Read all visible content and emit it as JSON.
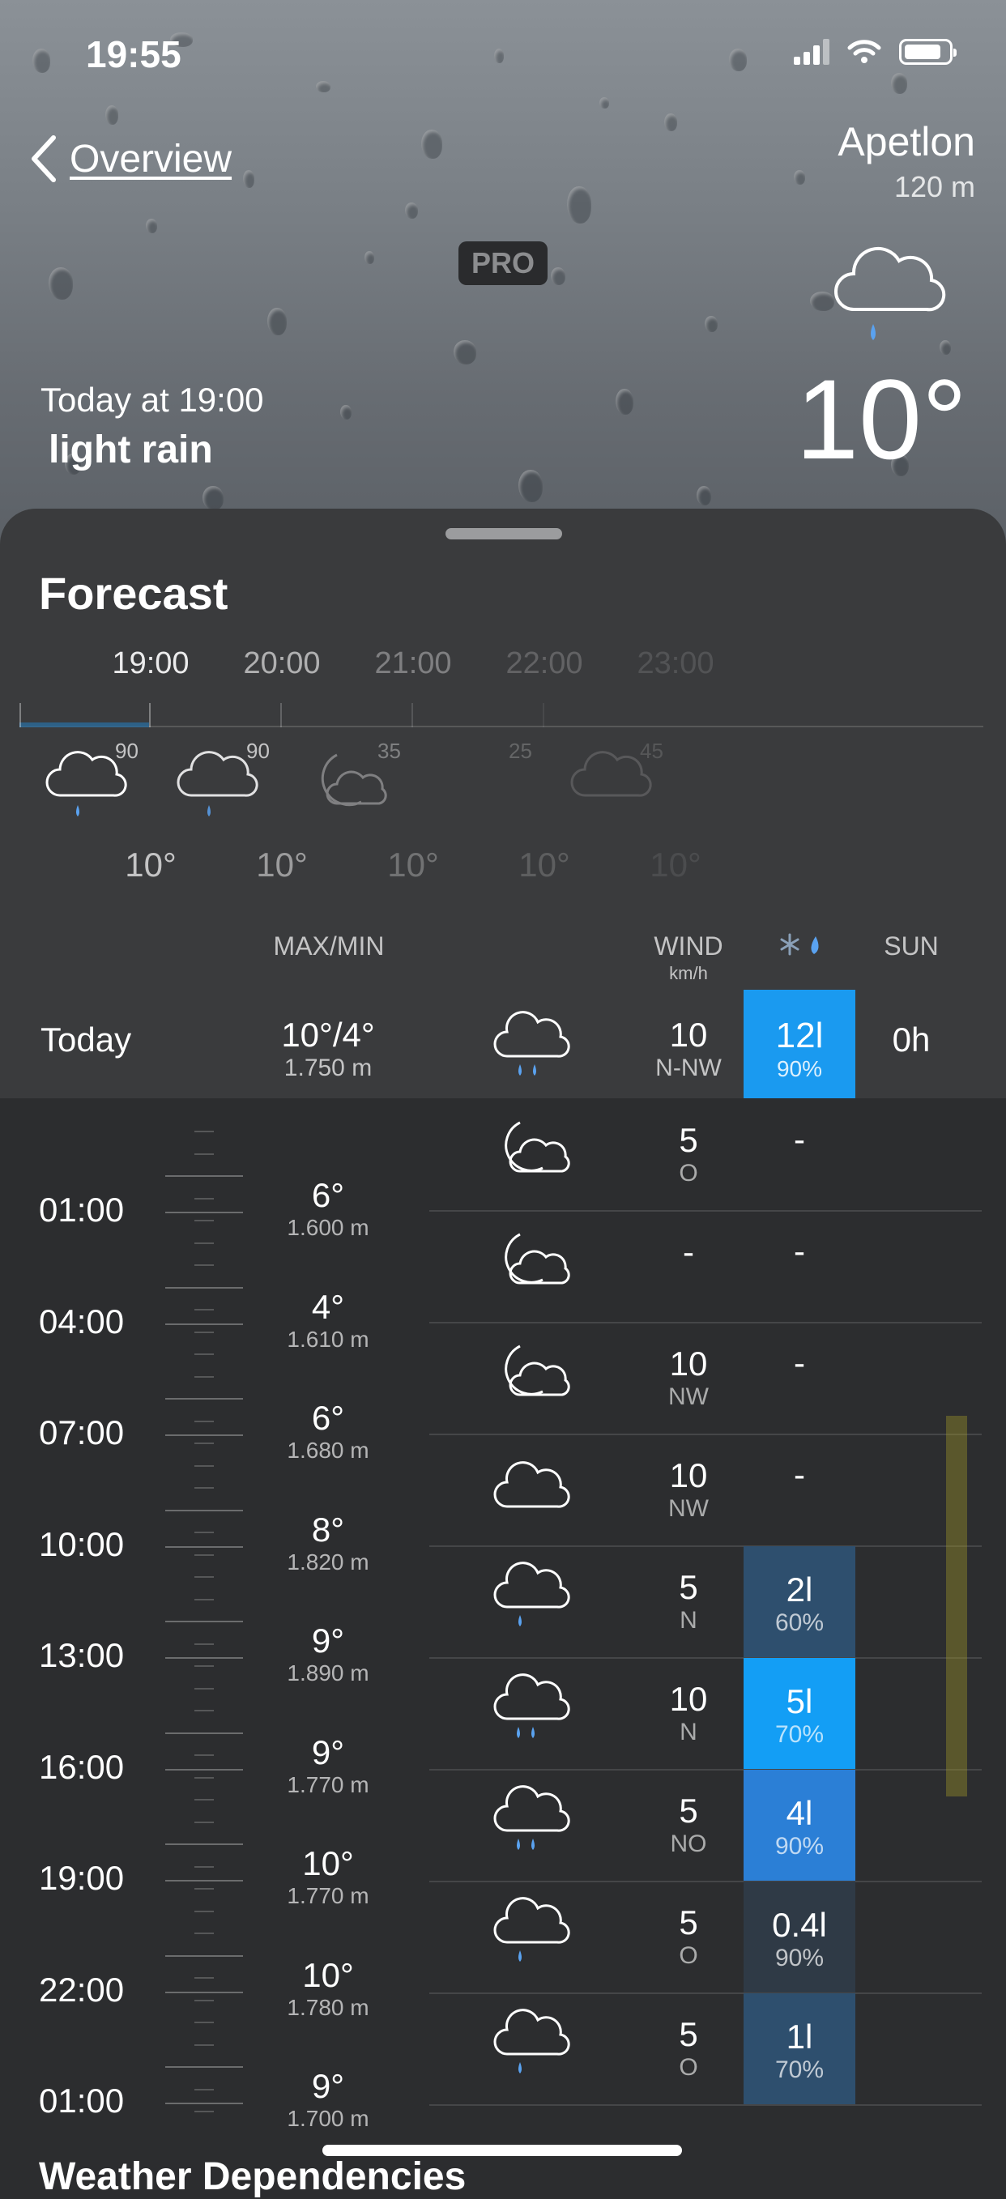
{
  "status": {
    "time": "19:55"
  },
  "nav": {
    "back_label": "Overview"
  },
  "location": {
    "name": "Apetlon",
    "elevation": "120 m"
  },
  "current": {
    "when": "Today at 19:00",
    "condition": "light rain",
    "temp": "10°",
    "icon": "cloud-light-rain-icon"
  },
  "forecast": {
    "title": "Forecast",
    "hourly": [
      {
        "time": "19:00",
        "icon": "cloud-rain-icon",
        "prob": "90",
        "temp": "10°"
      },
      {
        "time": "20:00",
        "icon": "cloud-rain-icon",
        "prob": "90",
        "temp": "10°"
      },
      {
        "time": "21:00",
        "icon": "moon-cloud-icon",
        "prob": "35",
        "temp": "10°"
      },
      {
        "time": "22:00",
        "icon": "cloud-rain-icon",
        "prob": "25",
        "temp": "10°"
      },
      {
        "time": "23:00",
        "icon": "cloud-icon",
        "prob": "45",
        "temp": "10°"
      }
    ],
    "pro_badge": "PRO"
  },
  "columns": {
    "maxmin": "MAX/MIN",
    "wind": "WIND",
    "wind_unit": "km/h",
    "sun": "SUN"
  },
  "today": {
    "label": "Today",
    "maxmin": "10°/4°",
    "snowline": "1.750 m",
    "icon": "cloud-rain-icon",
    "wind": "10",
    "wind_dir": "N-NW",
    "rain": "12l",
    "rain_prob": "90%",
    "sun": "0h"
  },
  "detail": {
    "time_labels": [
      "01:00",
      "04:00",
      "07:00",
      "10:00",
      "13:00",
      "16:00",
      "19:00",
      "22:00",
      "01:00"
    ],
    "temps": [
      {
        "t": "6°",
        "s": "1.600 m"
      },
      {
        "t": "4°",
        "s": "1.610 m"
      },
      {
        "t": "6°",
        "s": "1.680 m"
      },
      {
        "t": "8°",
        "s": "1.820 m"
      },
      {
        "t": "9°",
        "s": "1.890 m"
      },
      {
        "t": "9°",
        "s": "1.770 m"
      },
      {
        "t": "10°",
        "s": "1.770 m"
      },
      {
        "t": "10°",
        "s": "1.780 m"
      },
      {
        "t": "9°",
        "s": "1.700 m"
      }
    ],
    "rows": [
      {
        "icon": "moon-cloud-icon",
        "wind": "5",
        "dir": "O",
        "rain": "-",
        "prob": "",
        "color": ""
      },
      {
        "icon": "moon-cloud-icon",
        "wind": "-",
        "dir": "",
        "rain": "-",
        "prob": "",
        "color": ""
      },
      {
        "icon": "moon-cloud-icon",
        "wind": "10",
        "dir": "NW",
        "rain": "-",
        "prob": "",
        "color": ""
      },
      {
        "icon": "cloud-icon",
        "wind": "10",
        "dir": "NW",
        "rain": "-",
        "prob": "",
        "color": ""
      },
      {
        "icon": "cloud-light-rain-icon",
        "wind": "5",
        "dir": "N",
        "rain": "2l",
        "prob": "60%",
        "color": "#2e4f6e"
      },
      {
        "icon": "cloud-rain-icon",
        "wind": "10",
        "dir": "N",
        "rain": "5l",
        "prob": "70%",
        "color": "#139ef5"
      },
      {
        "icon": "cloud-rain-icon",
        "wind": "5",
        "dir": "NO",
        "rain": "4l",
        "prob": "90%",
        "color": "#2b7fd6"
      },
      {
        "icon": "cloud-light-rain-icon",
        "wind": "5",
        "dir": "O",
        "rain": "0.4l",
        "prob": "90%",
        "color": "#2f3a46"
      },
      {
        "icon": "cloud-light-rain-icon",
        "wind": "5",
        "dir": "O",
        "rain": "1l",
        "prob": "70%",
        "color": "#2e4f6e"
      }
    ]
  },
  "partial_section": {
    "title": "Weather Dependencies"
  }
}
